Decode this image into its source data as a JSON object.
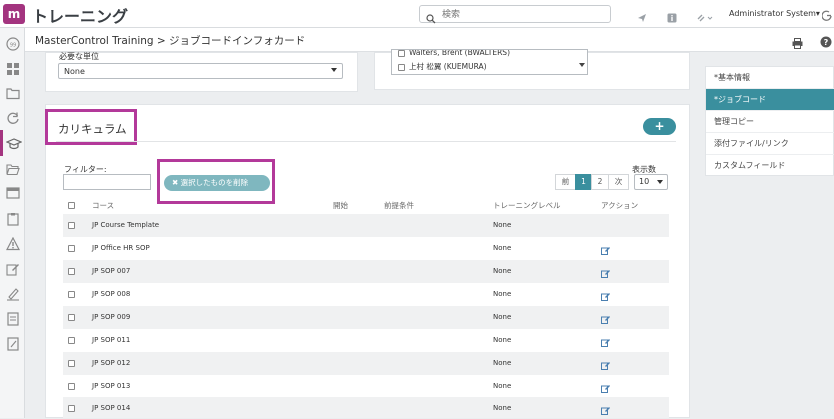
{
  "header": {
    "logo": "m",
    "app_title": "トレーニング",
    "search_placeholder": "検索",
    "user": "Administrator System▾"
  },
  "subheader": {
    "breadcrumb": "MasterControl Training > ジョブコードインフォカード"
  },
  "top_panels": {
    "left_label": "必要な単位",
    "left_select_value": "None",
    "right_list": [
      "Walters, Brent (BWALTERS)",
      "上村 松翼 (KUEMURA)"
    ]
  },
  "curriculum": {
    "title": "カリキュラム",
    "add_label": "+",
    "filter_label": "フィルター:",
    "delete_selected": "✖ 選択したものを削除",
    "pager": {
      "prev": "前",
      "page1": "1",
      "page2": "2",
      "next": "次"
    },
    "per_page_label": "表示数",
    "per_page_value": "10",
    "columns": {
      "course": "コース",
      "start": "開始",
      "prereq": "前提条件",
      "level": "トレーニングレベル",
      "action": "アクション"
    },
    "rows": [
      {
        "course": "JP Course Template",
        "level": "None"
      },
      {
        "course": "JP Office HR SOP",
        "level": "None"
      },
      {
        "course": "JP SOP 007",
        "level": "None"
      },
      {
        "course": "JP SOP 008",
        "level": "None"
      },
      {
        "course": "JP SOP 009",
        "level": "None"
      },
      {
        "course": "JP SOP 011",
        "level": "None"
      },
      {
        "course": "JP SOP 012",
        "level": "None"
      },
      {
        "course": "JP SOP 013",
        "level": "None"
      },
      {
        "course": "JP SOP 014",
        "level": "None"
      }
    ]
  },
  "right_nav": [
    {
      "label": "*基本情報",
      "active": false
    },
    {
      "label": "*ジョブコード",
      "active": true
    },
    {
      "label": "管理コピー",
      "active": false
    },
    {
      "label": "添付ファイル/リンク",
      "active": false
    },
    {
      "label": "カスタムフィールド",
      "active": false
    }
  ],
  "colors": {
    "accent": "#3a8f9e",
    "brand": "#a3347f",
    "highlight": "#b3399a"
  }
}
